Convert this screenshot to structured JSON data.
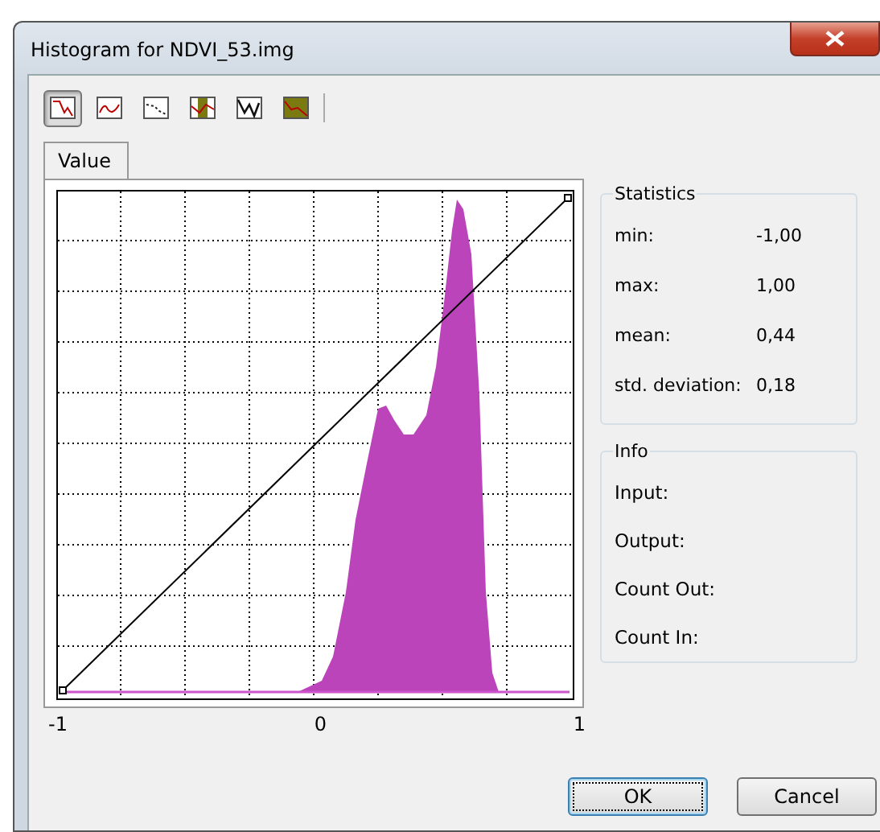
{
  "window": {
    "title": "Histogram for NDVI_53.img"
  },
  "toolbar": [
    {
      "kind": "steps",
      "selected": true
    },
    {
      "kind": "wave",
      "selected": false
    },
    {
      "kind": "dots",
      "selected": false
    },
    {
      "kind": "band",
      "selected": false
    },
    {
      "kind": "zigzag",
      "selected": false
    },
    {
      "kind": "area",
      "selected": false
    }
  ],
  "tabs": [
    {
      "label": "Value",
      "selected": true
    }
  ],
  "histogram": {
    "x_labels": [
      "-1",
      "0",
      "1"
    ]
  },
  "statistics": {
    "title": "Statistics",
    "rows": [
      {
        "label": "min:",
        "value": "-1,00"
      },
      {
        "label": "max:",
        "value": "1,00"
      },
      {
        "label": "mean:",
        "value": "0,44"
      },
      {
        "label": "std. deviation:",
        "value": "0,18"
      }
    ]
  },
  "info": {
    "title": "Info",
    "rows": [
      "Input:",
      "Output:",
      "Count Out:",
      "Count In:"
    ]
  },
  "buttons": [
    {
      "label": "OK",
      "default": true
    },
    {
      "label": "Cancel",
      "default": false
    }
  ]
}
